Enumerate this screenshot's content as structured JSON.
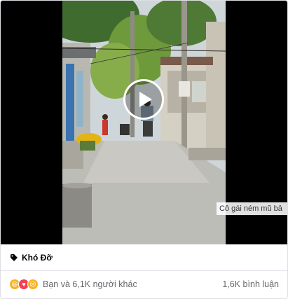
{
  "video": {
    "caption": "Cô gái ném mũ bả",
    "play_icon": "play-icon"
  },
  "page": {
    "name": "Khó Đỡ",
    "tag_icon": "tag-icon"
  },
  "reactions": {
    "icons": [
      "haha-icon",
      "love-icon",
      "sad-icon"
    ],
    "summary": "Bạn và 6,1K người khác",
    "comments": "1,6K bình luận"
  },
  "colors": {
    "secondary_text": "#65676b",
    "haha": "#f7b125",
    "love": "#f33e58"
  }
}
